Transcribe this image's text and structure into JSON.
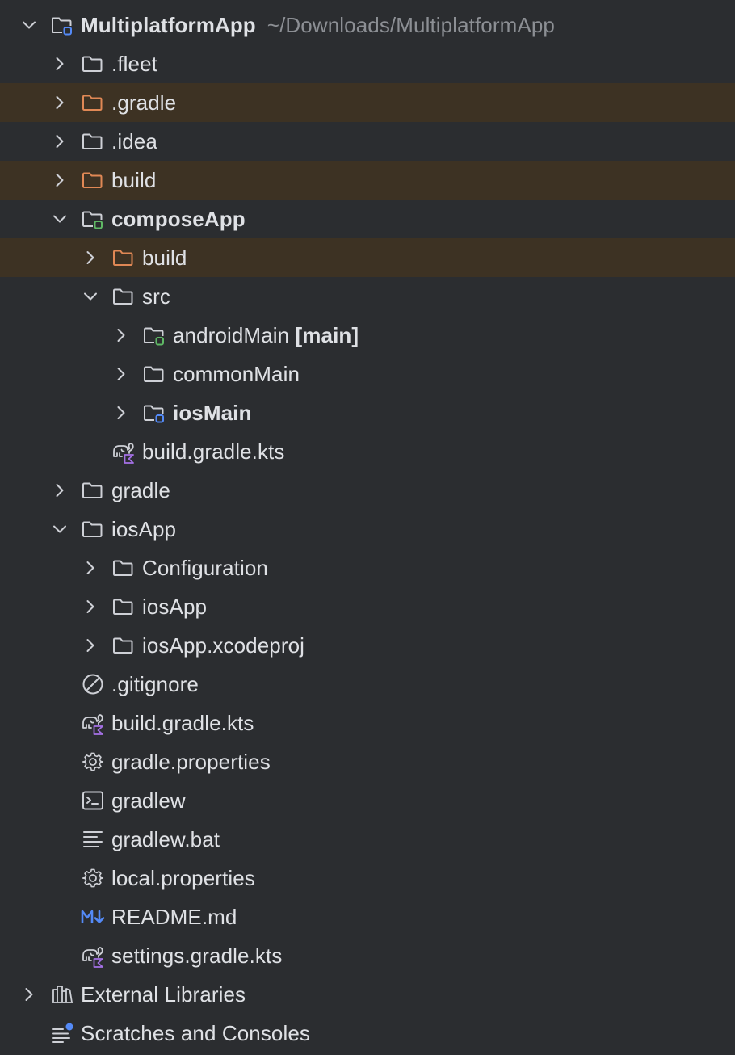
{
  "colors": {
    "background": "#2b2d30",
    "excluded_row": "#3d3223",
    "text": "#dfe1e5",
    "hint_text": "#8c8f94",
    "folder_icon": "#ced0d6",
    "excluded_folder_icon": "#e08855",
    "module_blue_badge": "#548af7",
    "module_green_badge": "#5fb865",
    "kotlin_purple": "#a571e6",
    "markdown_blue": "#548af7"
  },
  "tree": {
    "root": {
      "label": "MultiplatformApp",
      "path": "~/Downloads/MultiplatformApp",
      "icon": "module-folder-icon",
      "expanded": true
    },
    "items": [
      {
        "label": ".fleet",
        "icon": "folder-icon",
        "expanded": false,
        "excluded": false
      },
      {
        "label": ".gradle",
        "icon": "excluded-folder-icon",
        "expanded": false,
        "excluded": true
      },
      {
        "label": ".idea",
        "icon": "folder-icon",
        "expanded": false,
        "excluded": false
      },
      {
        "label": "build",
        "icon": "excluded-folder-icon",
        "expanded": false,
        "excluded": true
      },
      {
        "label": "composeApp",
        "icon": "module-folder-icon",
        "expanded": true,
        "bold": true
      },
      {
        "label": "build",
        "icon": "excluded-folder-icon",
        "expanded": false,
        "excluded": true
      },
      {
        "label": "src",
        "icon": "folder-icon",
        "expanded": true
      },
      {
        "label": "androidMain",
        "tag": "[main]",
        "icon": "source-root-folder-icon",
        "expanded": false
      },
      {
        "label": "commonMain",
        "icon": "folder-icon",
        "expanded": false
      },
      {
        "label": "iosMain",
        "icon": "module-folder-icon",
        "expanded": false,
        "bold": true
      },
      {
        "label": "build.gradle.kts",
        "icon": "gradle-kotlin-icon"
      },
      {
        "label": "gradle",
        "icon": "folder-icon",
        "expanded": false
      },
      {
        "label": "iosApp",
        "icon": "folder-icon",
        "expanded": true
      },
      {
        "label": "Configuration",
        "icon": "folder-icon",
        "expanded": false
      },
      {
        "label": "iosApp",
        "icon": "folder-icon",
        "expanded": false
      },
      {
        "label": "iosApp.xcodeproj",
        "icon": "folder-icon",
        "expanded": false
      },
      {
        "label": ".gitignore",
        "icon": "ignore-file-icon"
      },
      {
        "label": "build.gradle.kts",
        "icon": "gradle-kotlin-icon"
      },
      {
        "label": "gradle.properties",
        "icon": "gear-icon"
      },
      {
        "label": "gradlew",
        "icon": "terminal-icon"
      },
      {
        "label": "gradlew.bat",
        "icon": "text-file-icon"
      },
      {
        "label": "local.properties",
        "icon": "gear-icon"
      },
      {
        "label": "README.md",
        "icon": "markdown-icon"
      },
      {
        "label": "settings.gradle.kts",
        "icon": "gradle-kotlin-icon"
      }
    ],
    "external_libraries": {
      "label": "External Libraries",
      "icon": "library-icon",
      "expanded": false
    },
    "scratches": {
      "label": "Scratches and Consoles",
      "icon": "scratches-icon"
    }
  }
}
